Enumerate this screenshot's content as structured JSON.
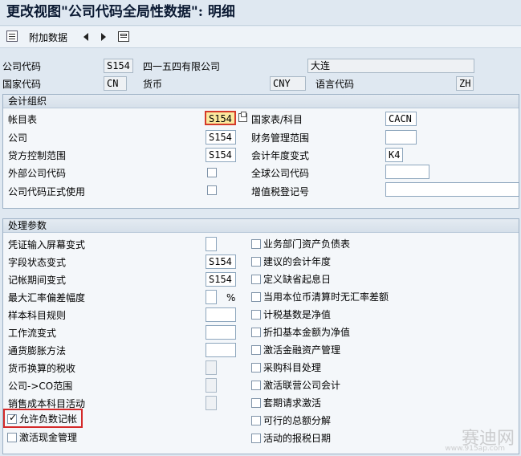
{
  "window": {
    "title": "更改视图\"公司代码全局性数据\": 明细"
  },
  "toolbar": {
    "additional_data_label": "附加数据"
  },
  "header": {
    "company_code_label": "公司代码",
    "company_code_value": "S154",
    "company_name": "四一五四有限公司",
    "city": "大连",
    "country_code_label": "国家代码",
    "country_code_value": "CN",
    "currency_label": "货币",
    "currency_value": "CNY",
    "language_label": "语言代码",
    "language_value": "ZH"
  },
  "accounting": {
    "section_title": "会计组织",
    "chart_of_accounts_label": "帐目表",
    "chart_of_accounts_value": "S154",
    "country_chart_label": "国家表/科目",
    "country_chart_value": "CACN",
    "company_label": "公司",
    "company_value": "S154",
    "fm_area_label": "财务管理范围",
    "fm_area_value": "",
    "credit_control_label": "贷方控制范围",
    "credit_control_value": "S154",
    "fiscal_year_variant_label": "会计年度变式",
    "fiscal_year_variant_value": "K4",
    "external_cc_label": "外部公司代码",
    "global_cc_label": "全球公司代码",
    "global_cc_value": "",
    "cc_productive_label": "公司代码正式使用",
    "vat_reg_label": "增值税登记号",
    "vat_reg_value": ""
  },
  "processing": {
    "section_title": "处理参数",
    "left": [
      {
        "label": "凭证输入屏幕变式",
        "value": ""
      },
      {
        "label": "字段状态变式",
        "value": "S154"
      },
      {
        "label": "记帐期间变式",
        "value": "S154"
      },
      {
        "label": "最大汇率偏差幅度",
        "value": "",
        "unit": "%"
      },
      {
        "label": "样本科目规则",
        "value": ""
      },
      {
        "label": "工作流变式",
        "value": ""
      },
      {
        "label": "通货膨胀方法",
        "value": ""
      },
      {
        "label": "货币换算的税收",
        "value": ""
      },
      {
        "label": "公司->CO范围",
        "value": ""
      },
      {
        "label": "销售成本科目活动",
        "value": ""
      }
    ],
    "right": [
      "业务部门资产负债表",
      "建议的会计年度",
      "定义缺省起息日",
      "当用本位币清算时无汇率差额",
      "计税基数是净值",
      "折扣基本金额为净值",
      "激活金融资产管理",
      "采购科目处理",
      "激活联营公司会计",
      "套期请求激活",
      "可行的总额分解",
      "活动的报税日期"
    ],
    "allow_negative_posting_label": "允许负数记帐",
    "allow_negative_posting_checked": true,
    "activate_cash_mgmt_label": "激活现金管理"
  },
  "watermark": {
    "text": "赛迪网",
    "url": "www.915ap.com"
  }
}
